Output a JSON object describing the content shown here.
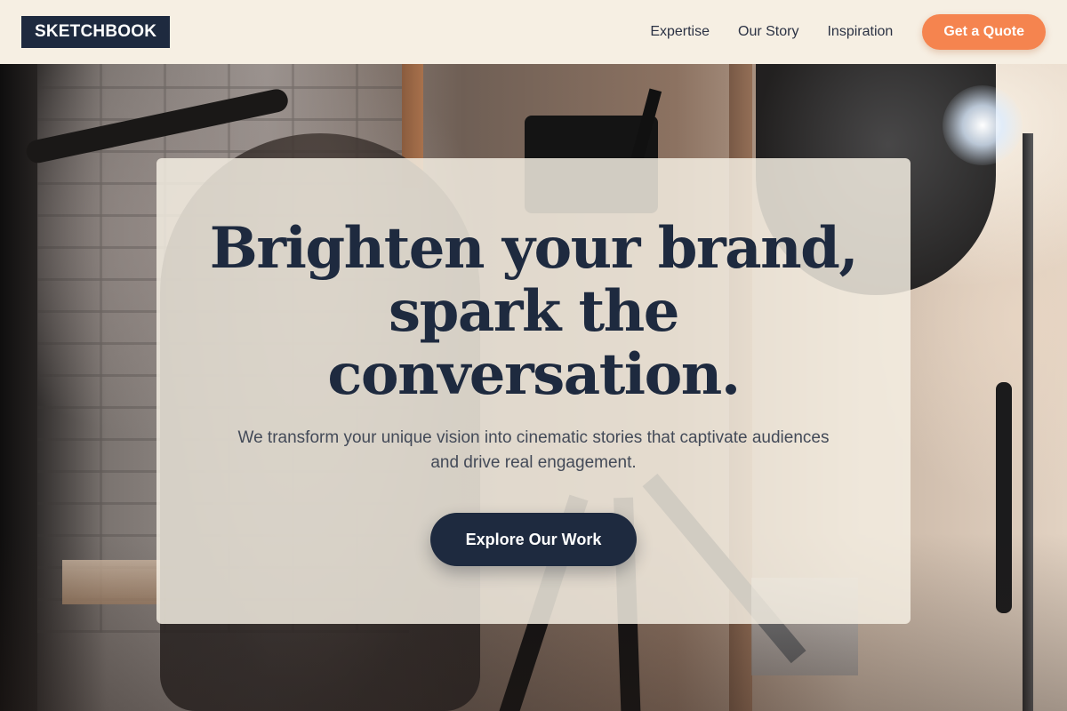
{
  "header": {
    "logo_text": "SKETCHBOOK",
    "nav_links": [
      {
        "label": "Expertise"
      },
      {
        "label": "Our Story"
      },
      {
        "label": "Inspiration"
      }
    ],
    "cta_label": "Get a Quote"
  },
  "hero": {
    "title": "Brighten your brand, spark the conversation.",
    "subtitle": "We transform your unique vision into cinematic stories that captivate audiences and drive real engagement.",
    "button_label": "Explore Our Work"
  },
  "colors": {
    "navy": "#1e2a3f",
    "accent_orange": "#f5844f",
    "header_cream": "#f6efe3"
  }
}
